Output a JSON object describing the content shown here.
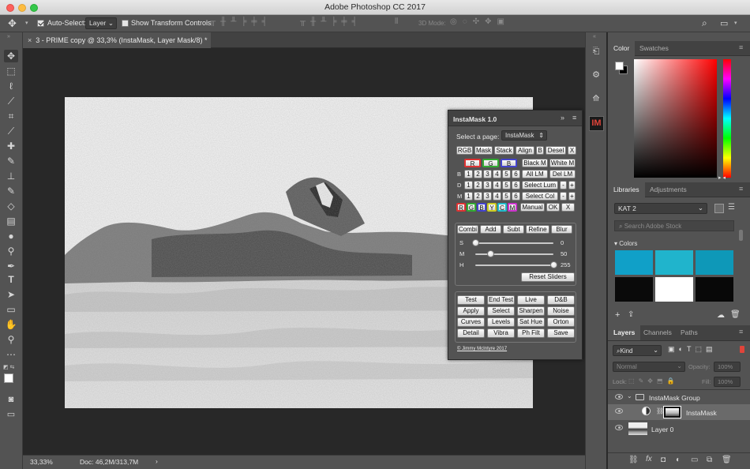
{
  "app": {
    "title": "Adobe Photoshop CC 2017"
  },
  "options_bar": {
    "auto_select_label": "Auto-Select:",
    "auto_select_value": "Layer",
    "show_transform_label": "Show Transform Controls",
    "mode3d_label": "3D Mode:"
  },
  "document": {
    "tab_title": "3 - PRIME copy @ 33,3% (InstaMask, Layer Mask/8) *",
    "close": "×",
    "zoom": "33,33%",
    "doc_size": "Doc: 46,2M/313,7M",
    "arrow": "›"
  },
  "instamask": {
    "title": "InstaMask 1.0",
    "page_label": "Select a page:",
    "page_value": "InstaMask",
    "row1": [
      "RGB",
      "Mask",
      "Stack",
      "Align",
      "B",
      "Desel",
      "X"
    ],
    "row2_rgb": [
      "R",
      "G",
      "B"
    ],
    "row2_extra": [
      "Black M",
      "White M"
    ],
    "num_rows": [
      {
        "label": "B",
        "nums": [
          "1",
          "2",
          "3",
          "4",
          "5",
          "6"
        ],
        "extra": [
          "All LM",
          "Del LM"
        ]
      },
      {
        "label": "D",
        "nums": [
          "1",
          "2",
          "3",
          "4",
          "5",
          "6"
        ],
        "extra": [
          "Select Lum",
          "-",
          "+"
        ]
      },
      {
        "label": "M",
        "nums": [
          "1",
          "2",
          "3",
          "4",
          "5",
          "6"
        ],
        "extra": [
          "Select Col",
          "-",
          "+"
        ]
      }
    ],
    "color_buttons": [
      "R",
      "G",
      "B",
      "Y",
      "C",
      "M"
    ],
    "color_extra": [
      "Manual",
      "OK",
      "X"
    ],
    "section_tabs": [
      "Combi",
      "Add",
      "Subt",
      "Refine",
      "Blur"
    ],
    "sliders": [
      {
        "label": "S",
        "value": 0
      },
      {
        "label": "M",
        "value": 50
      },
      {
        "label": "H",
        "value": 255
      }
    ],
    "slider_max": 255,
    "reset_sliders": "Reset Sliders",
    "action_grid": [
      [
        "Test",
        "End Test",
        "Live",
        "D&B"
      ],
      [
        "Apply",
        "Select",
        "Sharpen",
        "Noise"
      ],
      [
        "Curves",
        "Levels",
        "Sat Hue",
        "Orton"
      ],
      [
        "Detail",
        "Vibra",
        "Ph Filt",
        "Save"
      ]
    ],
    "copyright": "© Jimmy McIntyre 2017"
  },
  "color_panel": {
    "tabs": [
      "Color",
      "Swatches"
    ],
    "hue_color": "#ff0000"
  },
  "libraries_panel": {
    "tabs": [
      "Libraries",
      "Adjustments"
    ],
    "library_name": "KAT 2",
    "search_placeholder": "Search Adobe Stock",
    "colors_label": "Colors",
    "swatches": [
      "#10a0c8",
      "#20b4cc",
      "#0e98b8",
      "#0a0a0a",
      "#ffffff",
      "#080808"
    ]
  },
  "layers_panel": {
    "tabs": [
      "Layers",
      "Channels",
      "Paths"
    ],
    "kind_label": "Kind",
    "blend_mode": "Normal",
    "opacity_label": "Opacity:",
    "opacity_value": "100%",
    "lock_label": "Lock:",
    "fill_label": "Fill:",
    "fill_value": "100%",
    "layers": [
      {
        "name": "InstaMask Group"
      },
      {
        "name": "InstaMask"
      },
      {
        "name": "Layer 0"
      }
    ]
  },
  "colors": {
    "accent_red": "#e0443a",
    "panel_bg": "#535353"
  }
}
